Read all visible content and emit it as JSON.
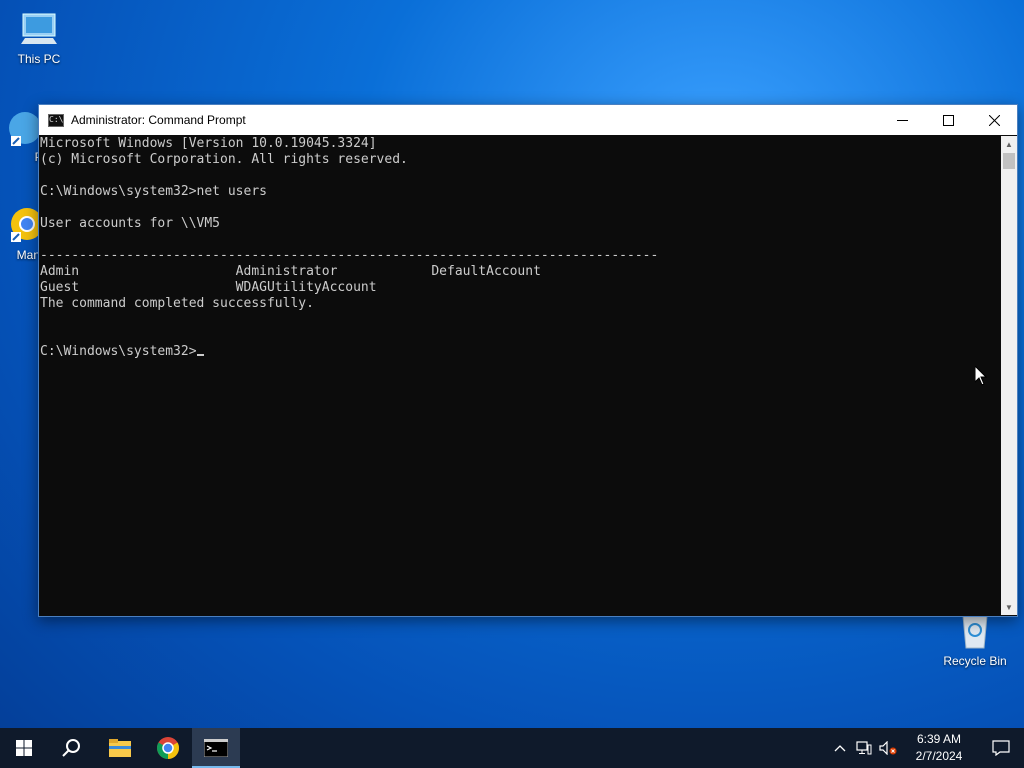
{
  "desktop": {
    "icons": [
      {
        "label": "This PC"
      },
      {
        "label": "Pal"
      },
      {
        "label": "Many"
      },
      {
        "label": "Recycle Bin"
      }
    ]
  },
  "window": {
    "title": "Administrator: Command Prompt",
    "console_lines": [
      "Microsoft Windows [Version 10.0.19045.3324]",
      "(c) Microsoft Corporation. All rights reserved.",
      "",
      "C:\\Windows\\system32>net users",
      "",
      "User accounts for \\\\VM5",
      "",
      "-------------------------------------------------------------------------------",
      "Admin                    Administrator            DefaultAccount",
      "Guest                    WDAGUtilityAccount",
      "The command completed successfully.",
      "",
      ""
    ],
    "prompt": "C:\\Windows\\system32>"
  },
  "taskbar": {
    "buttons": [
      {
        "icon": "windows-logo-icon"
      },
      {
        "icon": "search-icon"
      },
      {
        "icon": "file-explorer-icon"
      },
      {
        "icon": "chrome-icon"
      },
      {
        "icon": "command-prompt-icon",
        "active": true
      }
    ],
    "tray": {
      "time": "6:39 AM",
      "date": "2/7/2024"
    }
  },
  "colors": {
    "console_bg": "#0c0c0c",
    "console_fg": "#cccccc",
    "taskbar_bg": "#0f1a2b",
    "accent": "#76b9ed"
  }
}
